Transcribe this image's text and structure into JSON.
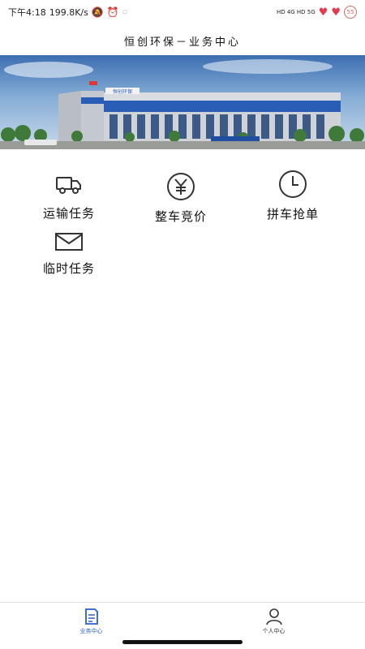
{
  "status_bar": {
    "time": "下午4:18",
    "speed": "199.8K/s",
    "net_labels": "HD 4G HD 5G"
  },
  "header": {
    "title": "恒创环保－业务中心"
  },
  "banner": {
    "building_sign": "恒创环保"
  },
  "menu": {
    "items": [
      {
        "label": "运输任务",
        "icon": "truck-icon"
      },
      {
        "label": "整车竞价",
        "icon": "yen-circle-icon"
      },
      {
        "label": "拼车抢单",
        "icon": "clock-icon"
      },
      {
        "label": "临时任务",
        "icon": "envelope-icon"
      }
    ]
  },
  "bottom_nav": {
    "items": [
      {
        "label": "业务中心",
        "icon": "document-icon",
        "active": true
      },
      {
        "label": "个人中心",
        "icon": "person-icon",
        "active": false
      }
    ]
  },
  "colors": {
    "accent": "#2a5cd8",
    "sky": "#5b8ccc",
    "building_blue": "#2a5db5"
  }
}
